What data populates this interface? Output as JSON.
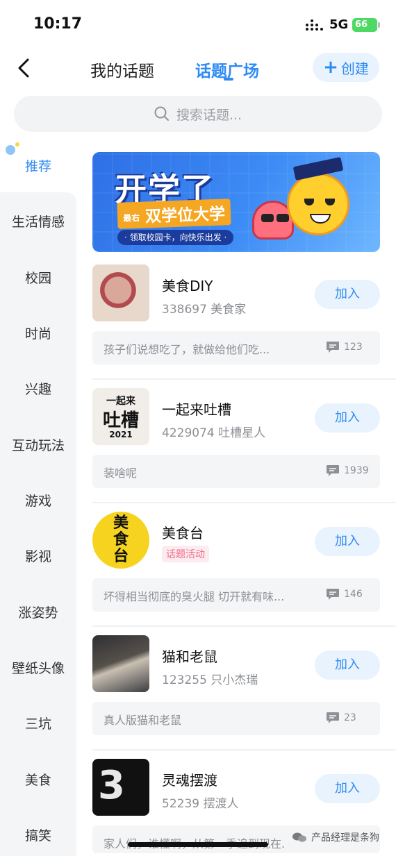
{
  "status": {
    "time": "10:17",
    "network": "5G",
    "battery": "66"
  },
  "nav": {
    "tab_mine": "我的话题",
    "tab_square": "话题广场",
    "create_label": "创建"
  },
  "search": {
    "placeholder": "搜索话题..."
  },
  "sidebar": {
    "items": [
      "推荐",
      "生活情感",
      "校园",
      "时尚",
      "兴趣",
      "互动玩法",
      "游戏",
      "影视",
      "涨姿势",
      "壁纸头像",
      "三坑",
      "美食",
      "搞笑"
    ],
    "active": "推荐"
  },
  "banner": {
    "title": "开学了",
    "small_label": "最右",
    "subtitle": "双学位大学",
    "pill": "· 领取校园卡，向快乐出发 ·"
  },
  "topics": [
    {
      "name": "美食DIY",
      "meta": "338697 美食家",
      "join": "加入",
      "preview": "孩子们说想吃了，就做给他们吃...",
      "count": "123",
      "cover": "food-photo"
    },
    {
      "name": "一起来吐槽",
      "meta": "4229074 吐槽星人",
      "join": "加入",
      "preview": "装啥呢",
      "count": "1939",
      "cover": "roast-logo",
      "cover_text": [
        "一起来",
        "吐槽",
        "2021"
      ]
    },
    {
      "name": "美食台",
      "tag": "话题活动",
      "join": "加入",
      "preview": "坏得相当彻底的臭火腿 切开就有味...",
      "count": "146",
      "cover": "yellow-logo",
      "cover_text": [
        "美",
        "食",
        "台"
      ]
    },
    {
      "name": "猫和老鼠",
      "meta": "123255 只小杰瑞",
      "join": "加入",
      "preview": "真人版猫和老鼠",
      "count": "23",
      "cover": "cartoon-still"
    },
    {
      "name": "灵魂摆渡",
      "meta": "52239 摆渡人",
      "join": "加入",
      "preview": "家人们，谁懂啊，从第一季追到现在...",
      "count": "",
      "cover": "drama-poster",
      "cover_text": [
        "3"
      ]
    }
  ],
  "watermark": {
    "text": "产品经理是条狗"
  },
  "colors": {
    "accent": "#2f8bf3",
    "join_bg": "#e8f3fd",
    "tag_pink": "#f06b8b"
  }
}
